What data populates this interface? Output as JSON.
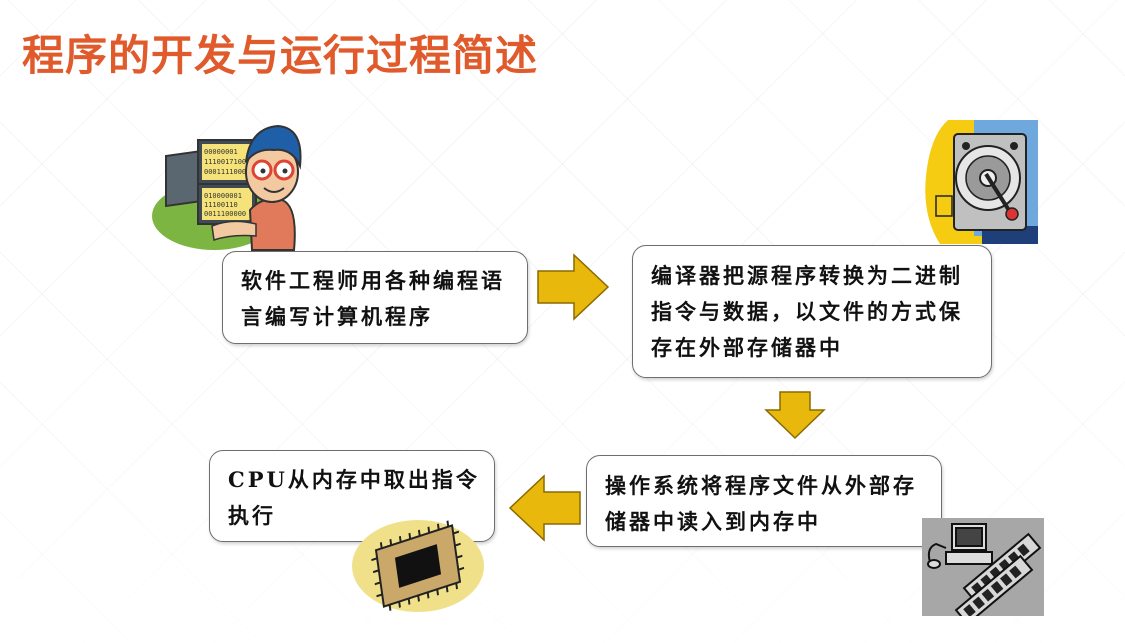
{
  "title": "程序的开发与运行过程简述",
  "steps": [
    "软件工程师用各种编程语言编写计算机程序",
    "编译器把源程序转换为二进制指令与数据，以文件的方式保存在外部存储器中",
    "操作系统将程序文件从外部存储器中读入到内存中",
    "CPU从内存中取出指令执行"
  ],
  "clipart": {
    "programmer_code_lines": [
      "00000001",
      "1110017100",
      "0001111000",
      "010000001",
      "11100110",
      "0011100000"
    ]
  },
  "colors": {
    "title": "#e05a2b",
    "arrow_fill": "#e8b80c",
    "arrow_stroke": "#8a6a00"
  }
}
